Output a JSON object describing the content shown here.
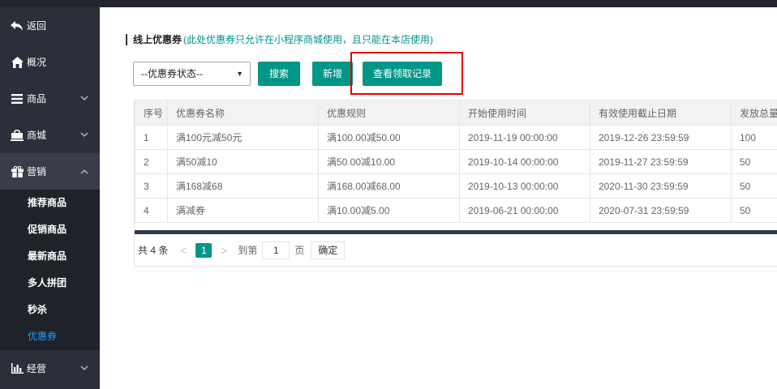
{
  "sidebar": {
    "items": [
      {
        "label": "返回",
        "icon": "back-arrow-icon",
        "chevron": false
      },
      {
        "label": "概况",
        "icon": "dashboard-icon",
        "chevron": false
      },
      {
        "label": "商品",
        "icon": "list-icon",
        "chevron": true
      },
      {
        "label": "商城",
        "icon": "shop-icon",
        "chevron": true
      },
      {
        "label": "营销",
        "icon": "gift-icon",
        "chevron": true
      }
    ],
    "sub_items": [
      "推荐商品",
      "促销商品",
      "最新商品",
      "多人拼团",
      "秒杀",
      "优惠券"
    ],
    "bottom_item": {
      "label": "经营",
      "icon": "bar-chart-icon"
    }
  },
  "heading": {
    "title": "线上优惠券",
    "note": "(此处优惠券只允许在小程序商城使用，且只能在本店使用)"
  },
  "toolbar": {
    "status_select": "--优惠券状态--",
    "search_label": "搜索",
    "add_label": "新增",
    "records_label": "查看领取记录"
  },
  "table": {
    "headers": [
      "序号",
      "优惠券名称",
      "优惠规则",
      "开始使用时间",
      "有效使用截止日期",
      "发放总量"
    ],
    "rows": [
      [
        "1",
        "满100元减50元",
        "满100.00减50.00",
        "2019-11-19 00:00:00",
        "2019-12-26 23:59:59",
        "100"
      ],
      [
        "2",
        "满50减10",
        "满50.00减10.00",
        "2019-10-14 00:00:00",
        "2019-11-27 23:59:59",
        "50"
      ],
      [
        "3",
        "满168减68",
        "满168.00减68.00",
        "2019-10-13 00:00:00",
        "2020-11-30 23:59:59",
        "50"
      ],
      [
        "4",
        "满减券",
        "满10.00减5.00",
        "2019-06-21 00:00:00",
        "2020-07-31 23:59:59",
        "50"
      ]
    ]
  },
  "pager": {
    "total": "共 4 条",
    "prev": "<",
    "current": "1",
    "next": ">",
    "goto_label": "到第",
    "goto_value": "1",
    "page_unit": "页",
    "confirm": "确定"
  },
  "colors": {
    "accent": "#009688",
    "sidebar": "#2b2f3a",
    "highlight": "#e60000",
    "active_link": "#1e9fff"
  }
}
